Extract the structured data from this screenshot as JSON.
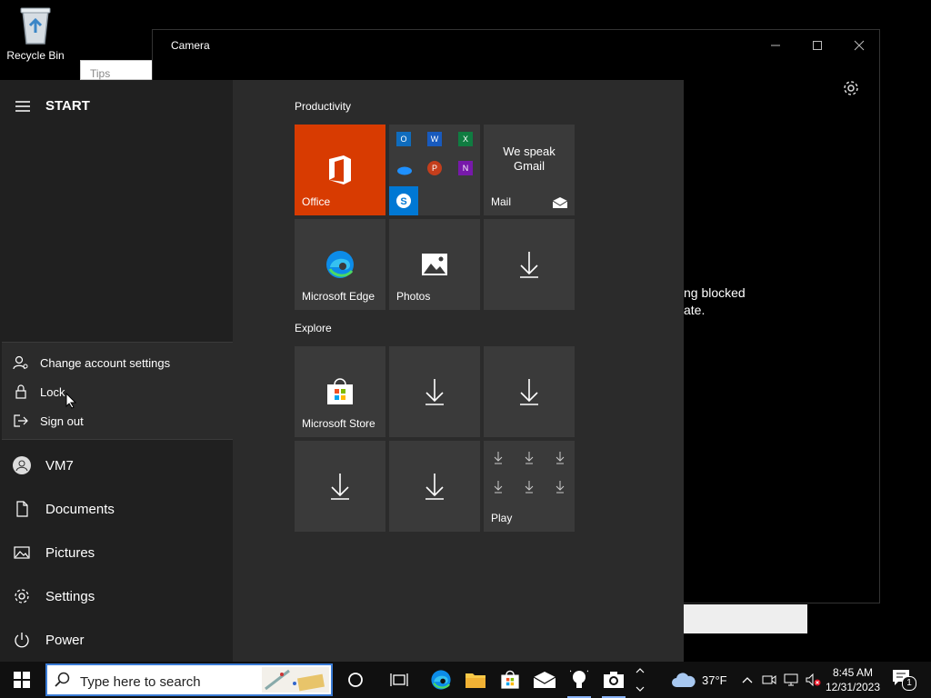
{
  "desktop": {
    "recycle_bin_label": "Recycle Bin",
    "tips_placeholder": "Tips"
  },
  "camera": {
    "title": "Camera",
    "message_line1": "ng blocked",
    "message_line2": "ate."
  },
  "start": {
    "header": "START",
    "account_menu": [
      "Change account settings",
      "Lock",
      "Sign out"
    ],
    "user_name": "VM7",
    "nav": [
      "Documents",
      "Pictures",
      "Settings",
      "Power"
    ],
    "groups": {
      "productivity": "Productivity",
      "explore": "Explore"
    },
    "tiles": {
      "office": "Office",
      "mail": "Mail",
      "mail_promo": "We speak Gmail",
      "edge": "Microsoft Edge",
      "photos": "Photos",
      "store": "Microsoft Store",
      "play": "Play"
    }
  },
  "taskbar": {
    "search_placeholder": "Type here to search",
    "weather_temp": "37°F",
    "time": "8:45 AM",
    "date": "12/31/2023",
    "notification_count": "1"
  },
  "colors": {
    "office_tile": "#d83b01",
    "skype_tile": "#0078d4",
    "accent": "#8ab4f8"
  }
}
